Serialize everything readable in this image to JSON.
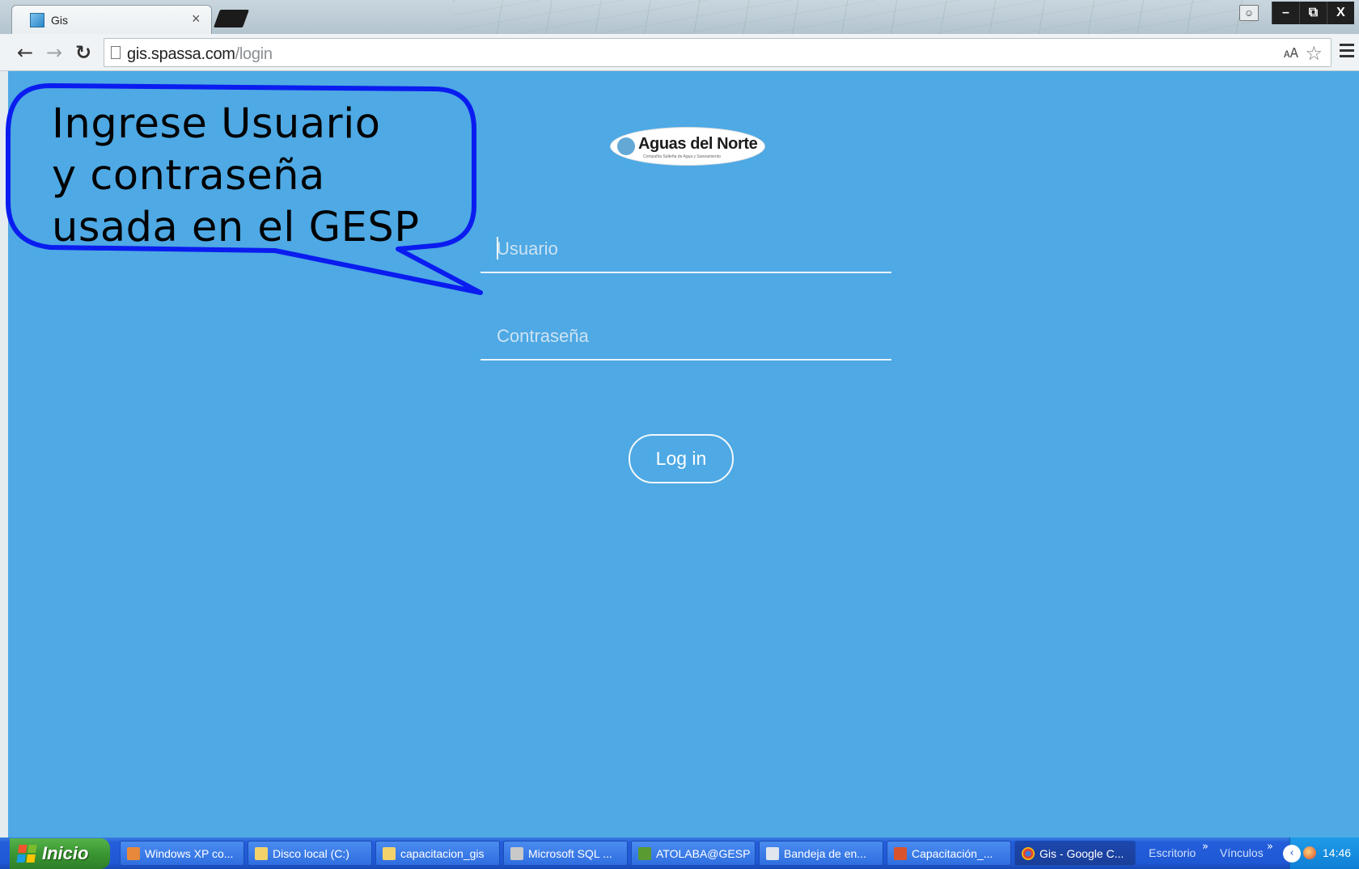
{
  "browser": {
    "tab_title": "Gis",
    "tab_close": "×",
    "url_domain": "gis.spassa.com",
    "url_path": "/login",
    "window_controls": [
      "–",
      "⧉",
      "X"
    ]
  },
  "page": {
    "logo_text": "Aguas del Norte",
    "logo_subtext": "Compañía Salteña de Agua y Saneamiento",
    "username_placeholder": "Usuario",
    "password_placeholder": "Contraseña",
    "login_label": "Log in",
    "background_color": "#4ea9e4"
  },
  "callout": {
    "lines": [
      "Ingrese Usuario",
      "y contraseña",
      "usada en el GESP"
    ],
    "stroke_color": "#0a1cf0"
  },
  "taskbar": {
    "start_label": "Inicio",
    "tasks": [
      {
        "label": "Windows XP co..."
      },
      {
        "label": "Disco local (C:)"
      },
      {
        "label": "capacitacion_gis"
      },
      {
        "label": "Microsoft SQL ..."
      },
      {
        "label": "ATOLABA@GESP"
      },
      {
        "label": "Bandeja de en..."
      },
      {
        "label": "Capacitación_..."
      },
      {
        "label": "Gis - Google C..."
      }
    ],
    "escritorio": "Escritorio",
    "vinculos": "Vínculos",
    "chevron": "»",
    "tray_arrow": "‹",
    "clock": "14:46"
  }
}
